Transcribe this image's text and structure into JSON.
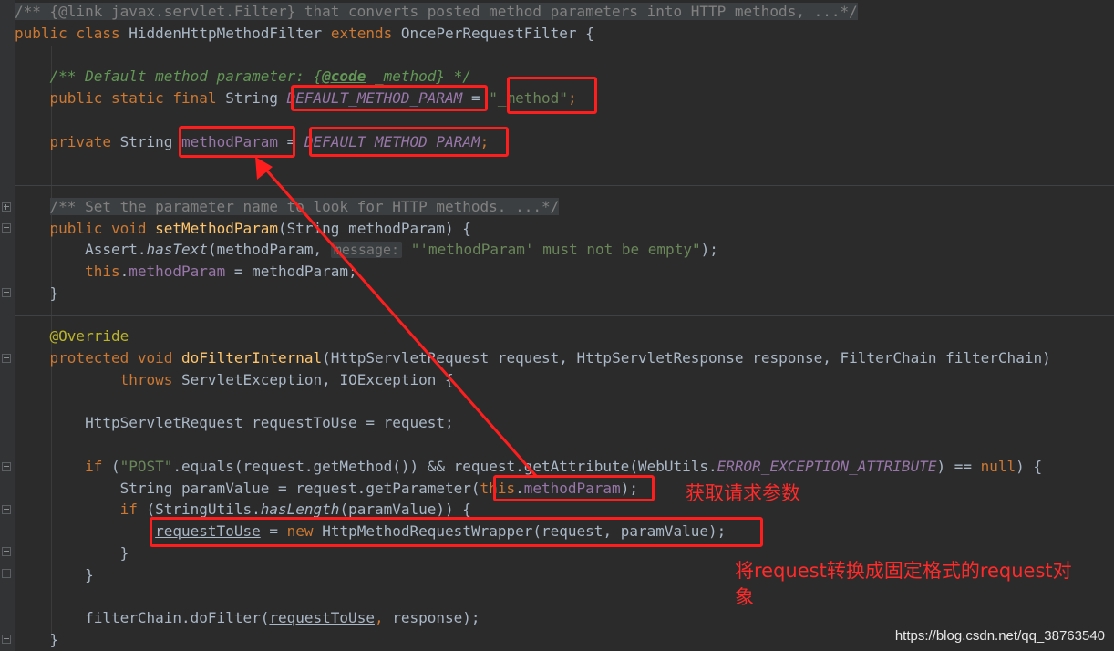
{
  "code": {
    "l1": {
      "c": "/** {@link javax.servlet.Filter} that converts posted method parameters into HTTP methods, ...*/"
    },
    "l2": {
      "a": "public",
      "b": "class",
      "c": "HiddenHttpMethodFilter",
      "d": "extends",
      "e": "OncePerRequestFilter {"
    },
    "l3": {
      "a": "/** Default method parameter: {",
      "b": "@code",
      "c": " _method} */"
    },
    "l4": {
      "a": "public",
      "b": "static",
      "c": "final",
      "d": "String",
      "e": "DEFAULT_METHOD_PARAM",
      "f": "=",
      "g": "\"_method\"",
      "h": ";"
    },
    "l5": {
      "a": "private",
      "b": "String",
      "c": "methodParam",
      "d": "=",
      "e": "DEFAULT_METHOD_PARAM",
      "f": ";"
    },
    "l6": {
      "c": "/** Set the parameter name to look for HTTP methods. ...*/"
    },
    "l7": {
      "a": "public",
      "b": "void",
      "c": "setMethodParam",
      "d": "(String methodParam) {"
    },
    "l8": {
      "a": "Assert.",
      "b": "hasText",
      "c": "(methodParam,",
      "d": "message:",
      "e": "\"'methodParam' must not be empty\"",
      "f": ");"
    },
    "l9": {
      "a": "this",
      "b": ".",
      "c": "methodParam",
      "d": " = methodParam;"
    },
    "l10": {
      "a": "}"
    },
    "l11": {
      "a": "@Override"
    },
    "l12": {
      "a": "protected",
      "b": "void",
      "c": "doFilterInternal",
      "d": "(HttpServletRequest request,",
      "e": "HttpServletResponse response,",
      "f": "FilterChain filterChain)"
    },
    "l13": {
      "a": "throws",
      "b": "ServletException,",
      "c": "IOException {"
    },
    "l14": {
      "a": "HttpServletRequest",
      "b": "requestToUse",
      "c": "= request;"
    },
    "l15": {
      "a": "if",
      "b": "(",
      "c": "\"POST\"",
      "d": ".equals(request.getMethod()) && request.getAttribute(WebUtils.",
      "e": "ERROR_EXCEPTION_ATTRIBUTE",
      "f": ") ==",
      "g": "null",
      "h": ") {"
    },
    "l16": {
      "a": "String paramValue = request.getParameter(",
      "b": "this",
      "c": ".",
      "d": "methodParam",
      "e": ");"
    },
    "l17": {
      "a": "if",
      "b": "(StringUtils.",
      "c": "hasLength",
      "d": "(paramValue)) {"
    },
    "l18": {
      "a": "requestToUse",
      "b": "=",
      "c": "new",
      "d": "HttpMethodRequestWrapper(request,",
      "e": "paramValue);"
    },
    "l19": {
      "a": "}"
    },
    "l20": {
      "a": "}"
    },
    "l21": {
      "a": "filterChain.doFilter(",
      "b": "requestToUse",
      "c": ",",
      "d": "response);"
    },
    "l22": {
      "a": "}"
    }
  },
  "annotations": {
    "get_param": "获取请求参数",
    "convert_line1": "将request转换成固定格式的request对",
    "convert_line2": "象"
  },
  "watermark": "https://blog.csdn.net/qq_38763540",
  "colors": {
    "background": "#2b2b2b",
    "keyword": "#cc7832",
    "string": "#6a8759",
    "field": "#9876aa",
    "method": "#ffc66d",
    "doc_comment": "#629755",
    "annotation_red": "#ff1e1e"
  }
}
